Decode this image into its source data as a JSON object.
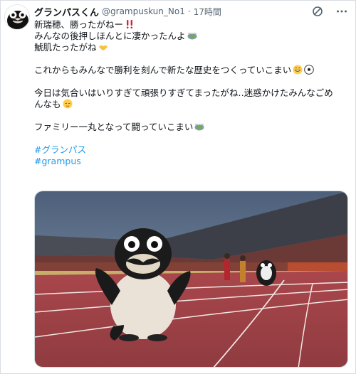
{
  "author": {
    "display_name": "グランパスくん",
    "handle": "@grampuskun_No1",
    "separator": "·",
    "time": "17時間"
  },
  "icons": {
    "header": [
      "grok-icon",
      "more-options-icon"
    ],
    "emoji": [
      "double-exclamation-icon",
      "stadium-icon",
      "handshake-icon",
      "grin-icon",
      "soccer-ball-icon",
      "relieved-icon",
      "stadium-icon"
    ]
  },
  "post": {
    "line1": "新瑞穂、勝ったがねー",
    "line2": "みんなの後押しほんとに凄かったんよ",
    "line3": "鯱肌たったがね",
    "line4": "これからもみんなで勝利を刻んで新たな歴史をつくっていこまい",
    "line5": "今日は気合いはいりすぎて頑張りすぎてまったがね‥迷惑かけたみんなごめ",
    "line6": "んなも",
    "line7": "ファミリー一丸となって闘っていこまい",
    "hashtag1": "#グランパス",
    "hashtag2": "#grampus"
  },
  "colors": {
    "link": "#1d9bf0",
    "secondary_text": "#536471",
    "text": "#0f1419"
  }
}
